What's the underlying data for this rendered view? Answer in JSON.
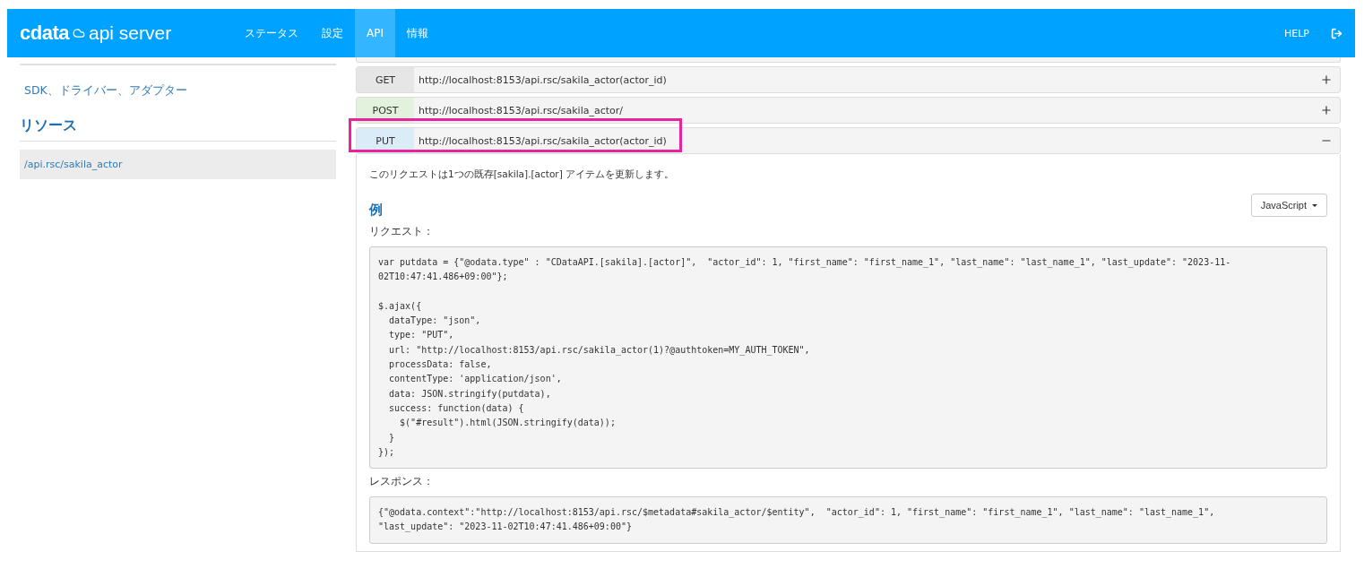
{
  "navbar": {
    "logo_brand": "cdata",
    "logo_product": "api server",
    "tabs": [
      {
        "label": "ステータス",
        "selected": false
      },
      {
        "label": "設定",
        "selected": false
      },
      {
        "label": "API",
        "selected": true
      },
      {
        "label": "情報",
        "selected": false
      }
    ],
    "help": "HELP"
  },
  "sidebar": {
    "link": "SDK、ドライバー、アダプター",
    "heading": "リソース",
    "items": [
      {
        "label": "/api.rsc/sakila_actor",
        "selected": true
      }
    ]
  },
  "endpoints": [
    {
      "method": "GET",
      "color": "#e6e6e6",
      "url": "http://localhost:8153/api.rsc/sakila_actor(actor_id)",
      "expanded": false,
      "highlighted": false
    },
    {
      "method": "POST",
      "color": "#e3f2dc",
      "url": "http://localhost:8153/api.rsc/sakila_actor/",
      "expanded": false,
      "highlighted": false
    },
    {
      "method": "PUT",
      "color": "#d9ecf8",
      "url": "http://localhost:8153/api.rsc/sakila_actor(actor_id)",
      "expanded": true,
      "highlighted": true
    }
  ],
  "detail": {
    "description": "このリクエストは1つの既存[sakila].[actor] アイテムを更新します。",
    "example_heading": "例",
    "language": "JavaScript",
    "request_label": "リクエスト：",
    "request_code": [
      [
        "var putdata = {\"@odata.type\" : \"CDataAPI.[sakila].[actor]\",  \"actor_id\": 1, \"first_name\": \"first_name_1\", \"last_name\": \"last_name_1\", \"last_update\": \"2023-11-",
        "02T10:47:41.486+09:00\"};"
      ],
      [
        "$.ajax({",
        "  dataType: \"json\",",
        "  type: \"PUT\",",
        "  url: \"http://localhost:8153/api.rsc/sakila_actor(1)?@authtoken=MY_AUTH_TOKEN\",",
        "  processData: false,",
        "  contentType: 'application/json',",
        "  data: JSON.stringify(putdata),",
        "  success: function(data) {",
        "    $(\"#result\").html(JSON.stringify(data));",
        "  }",
        "});"
      ]
    ],
    "response_label": "レスポンス：",
    "response_code": [
      "{\"@odata.context\":\"http://localhost:8153/api.rsc/$metadata#sakila_actor/$entity\",  \"actor_id\": 1, \"first_name\": \"first_name_1\", \"last_name\": \"last_name_1\",",
      "\"last_update\": \"2023-11-02T10:47:41.486+09:00\"}"
    ]
  }
}
